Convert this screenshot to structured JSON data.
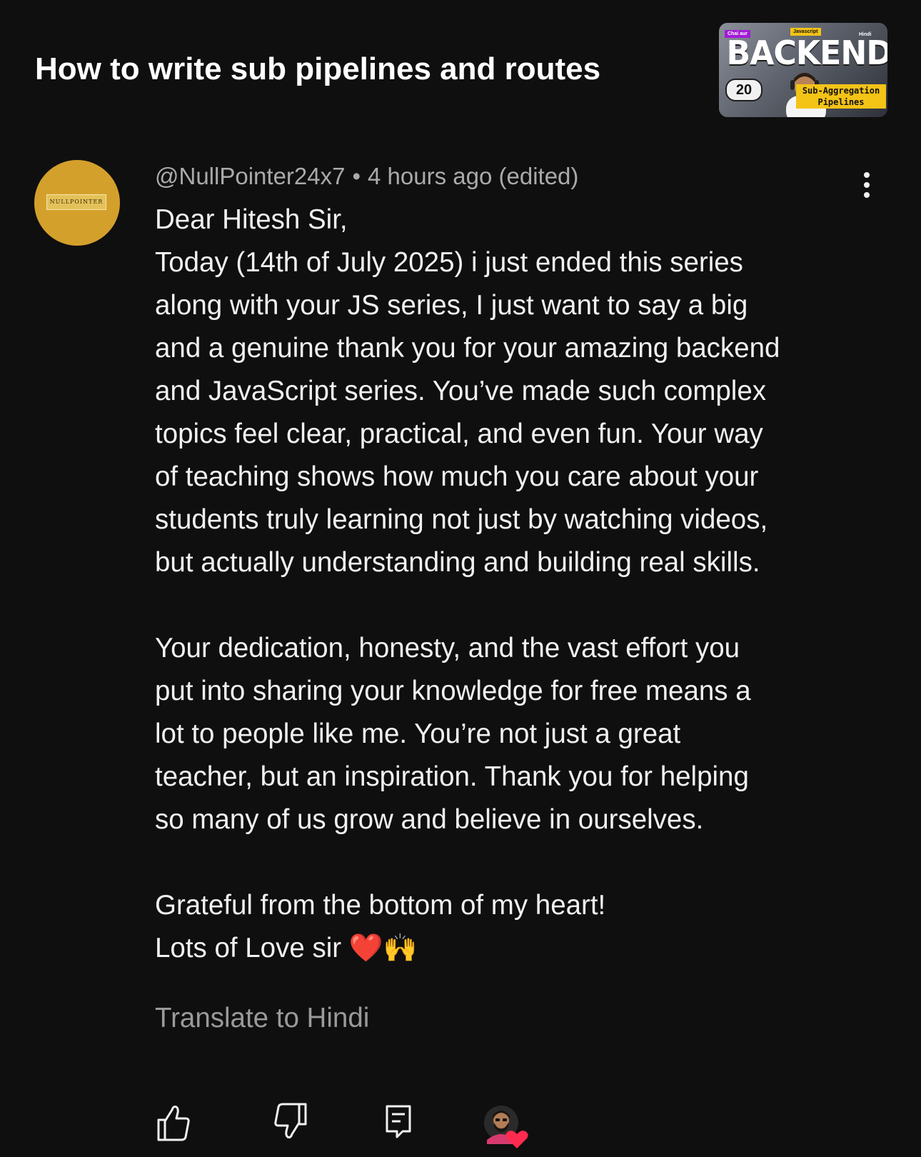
{
  "video": {
    "title": "How to write sub pipelines and routes",
    "thumbnail": {
      "chip_left": "Chai aur",
      "chip_top": "Javascript",
      "chip_right": "Hindi",
      "headline": "BACKEND",
      "episode": "20",
      "tag_line1": "Sub-Aggregation",
      "tag_line2": "Pipelines"
    }
  },
  "comment": {
    "avatar_text": "NULLPOINTER",
    "author": "@NullPointer24x7",
    "separator": "•",
    "time": "4 hours ago (edited)",
    "menu_icon": "more-vertical-icon",
    "paragraphs": [
      [
        "Dear Hitesh Sir,",
        "Today (14th of July 2025) i just ended this series",
        "along with your JS series, I just want to say a big",
        "and a genuine thank you for your amazing backend",
        "and JavaScript series. You’ve made such complex",
        "topics feel clear, practical, and even fun. Your way",
        "of teaching shows how much you care about your",
        "students truly learning not just by watching videos,",
        "but actually understanding and building real skills."
      ],
      [
        "Your dedication, honesty, and the vast effort you",
        "put into sharing your knowledge for free means a",
        "lot to people like me. You’re not just a great",
        "teacher, but an inspiration. Thank you for helping",
        "so many of us grow and believe in ourselves."
      ],
      [
        "Grateful from the bottom of my heart!",
        "Lots of Love sir ❤️🙌"
      ]
    ],
    "translate_label": "Translate to Hindi"
  },
  "actions": {
    "like_icon": "thumbs-up-icon",
    "dislike_icon": "thumbs-down-icon",
    "reply_icon": "reply-comment-icon",
    "creator_heart_icon": "creator-heart-icon"
  },
  "colors": {
    "background": "#0f0f0f",
    "text": "#f1f1f1",
    "secondary_text": "#aaaaaa",
    "heart": "#ff2a4f",
    "avatar_bg": "#d4a02c"
  }
}
